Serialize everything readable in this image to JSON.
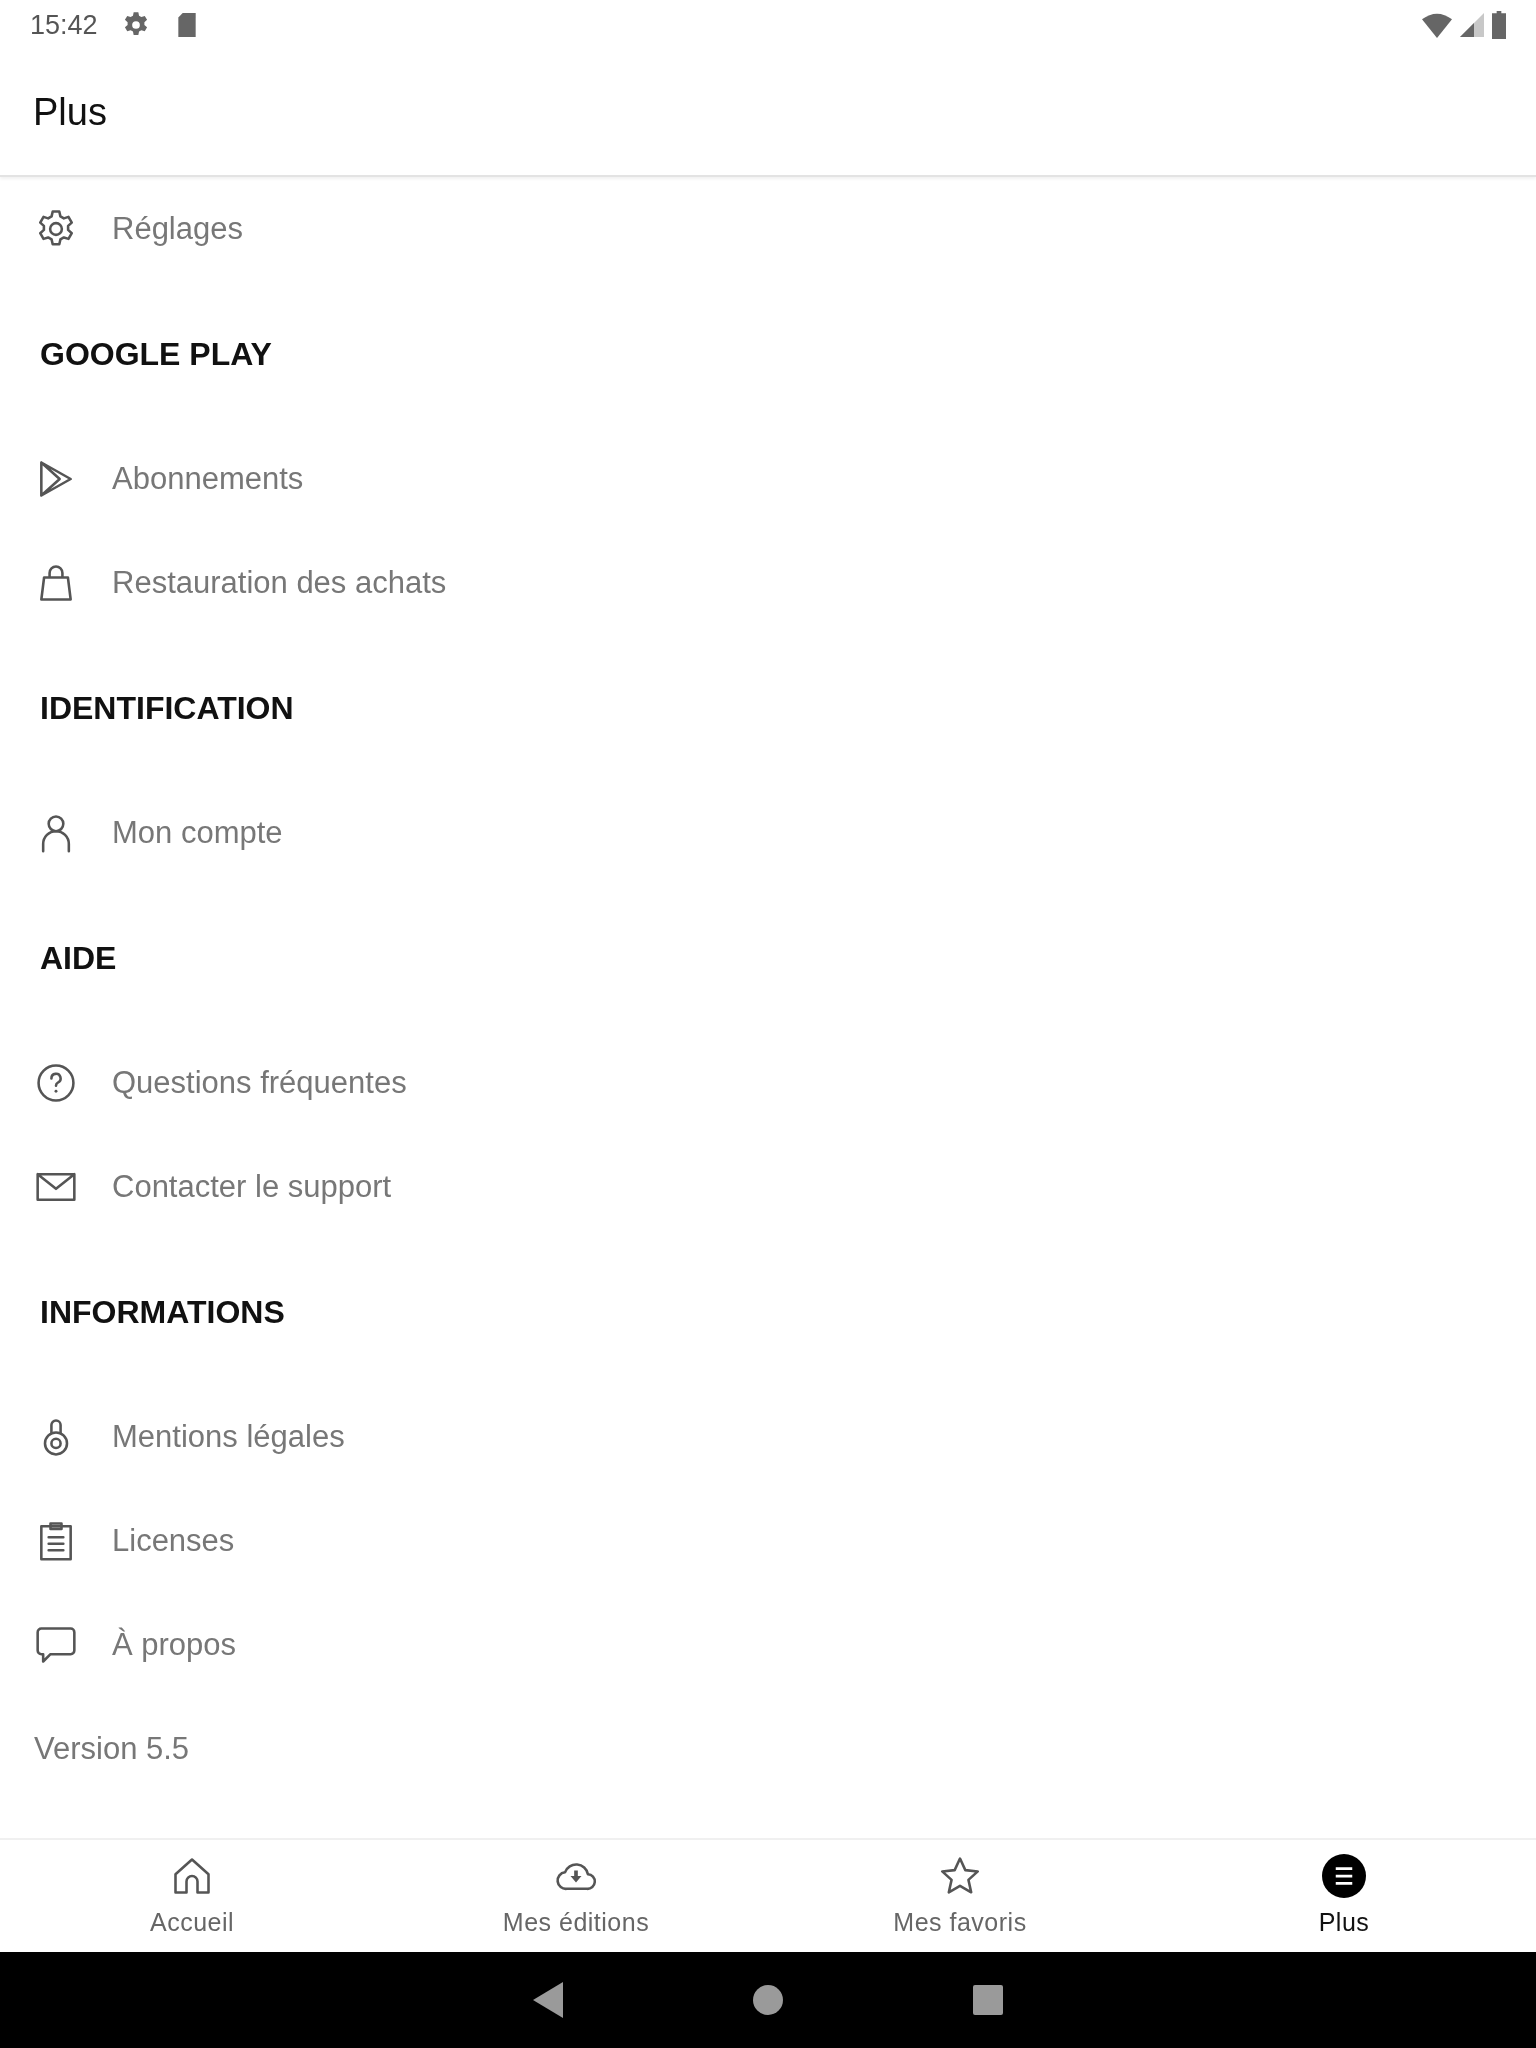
{
  "status_bar": {
    "time": "15:42"
  },
  "app_bar": {
    "title": "Plus"
  },
  "sections": [
    {
      "items": [
        {
          "label": "Réglages"
        }
      ]
    },
    {
      "header": "GOOGLE PLAY",
      "items": [
        {
          "label": "Abonnements"
        },
        {
          "label": "Restauration des achats"
        }
      ]
    },
    {
      "header": "IDENTIFICATION",
      "items": [
        {
          "label": "Mon compte"
        }
      ]
    },
    {
      "header": "AIDE",
      "items": [
        {
          "label": "Questions fréquentes"
        },
        {
          "label": "Contacter le support"
        }
      ]
    },
    {
      "header": "INFORMATIONS",
      "items": [
        {
          "label": "Mentions légales"
        },
        {
          "label": "Licenses"
        },
        {
          "label": "À propos"
        }
      ]
    }
  ],
  "version": "Version 5.5",
  "bottom_nav": [
    {
      "label": "Accueil",
      "selected": false
    },
    {
      "label": "Mes éditions",
      "selected": false
    },
    {
      "label": "Mes favoris",
      "selected": false
    },
    {
      "label": "Plus",
      "selected": true
    }
  ]
}
